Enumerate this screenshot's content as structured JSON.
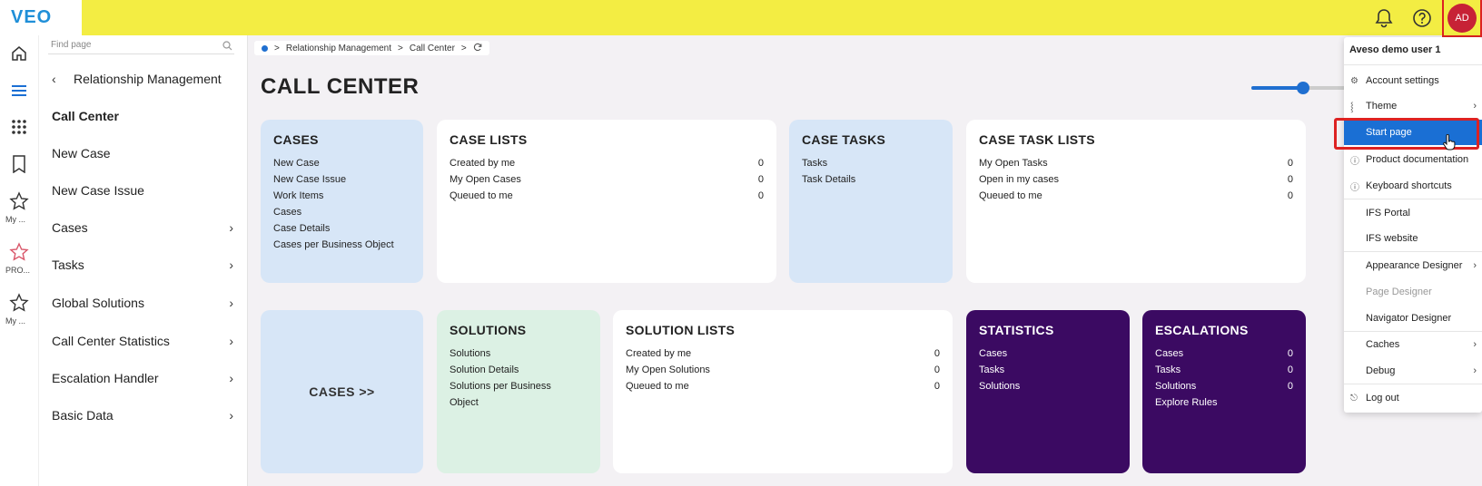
{
  "header": {
    "logo": "VEO",
    "user_initials": "AD",
    "icons": [
      "bell-icon",
      "help-icon"
    ]
  },
  "rail": {
    "labels": {
      "my1": "My ...",
      "pro": "PRO...",
      "my2": "My ..."
    }
  },
  "nav": {
    "search_placeholder": "Find page",
    "back_label": "Relationship Management",
    "items": [
      {
        "label": "Call Center",
        "active": true,
        "has_children": false
      },
      {
        "label": "New Case",
        "has_children": false
      },
      {
        "label": "New Case Issue",
        "has_children": false
      },
      {
        "label": "Cases",
        "has_children": true
      },
      {
        "label": "Tasks",
        "has_children": true
      },
      {
        "label": "Global Solutions",
        "has_children": true
      },
      {
        "label": "Call Center Statistics",
        "has_children": true
      },
      {
        "label": "Escalation Handler",
        "has_children": true
      },
      {
        "label": "Basic Data",
        "has_children": true
      }
    ]
  },
  "breadcrumb": [
    "Relationship Management",
    "Call Center"
  ],
  "page_title": "CALL CENTER",
  "tiles": {
    "cases": {
      "title": "CASES",
      "links": [
        "New Case",
        "New Case Issue",
        "Work Items",
        "Cases",
        "Case Details",
        "Cases per Business Object"
      ]
    },
    "case_lists": {
      "title": "CASE LISTS",
      "rows": [
        {
          "label": "Created by me",
          "value": "0"
        },
        {
          "label": "My Open Cases",
          "value": "0"
        },
        {
          "label": "Queued to me",
          "value": "0"
        }
      ]
    },
    "case_tasks": {
      "title": "CASE TASKS",
      "links": [
        "Tasks",
        "Task Details"
      ]
    },
    "case_task_lists": {
      "title": "CASE TASK LISTS",
      "rows": [
        {
          "label": "My Open Tasks",
          "value": "0"
        },
        {
          "label": "Open in my cases",
          "value": "0"
        },
        {
          "label": "Queued to me",
          "value": "0"
        }
      ]
    },
    "cases_link": {
      "label": "CASES >>"
    },
    "solutions": {
      "title": "SOLUTIONS",
      "links": [
        "Solutions",
        "Solution Details",
        "Solutions per Business",
        "Object"
      ]
    },
    "solution_lists": {
      "title": "SOLUTION LISTS",
      "rows": [
        {
          "label": "Created by me",
          "value": "0"
        },
        {
          "label": "My Open Solutions",
          "value": "0"
        },
        {
          "label": "Queued to me",
          "value": "0"
        }
      ]
    },
    "statistics": {
      "title": "STATISTICS",
      "links": [
        "Cases",
        "Tasks",
        "Solutions"
      ]
    },
    "escalations": {
      "title": "ESCALATIONS",
      "rows": [
        {
          "label": "Cases",
          "value": "0"
        },
        {
          "label": "Tasks",
          "value": "0"
        },
        {
          "label": "Solutions",
          "value": "0"
        },
        {
          "label": "Explore Rules",
          "value": ""
        }
      ]
    }
  },
  "zoom_level": 0.55,
  "user_menu": {
    "user_name": "Aveso demo user 1",
    "items": [
      {
        "label": "Account settings",
        "icon": "gear-icon"
      },
      {
        "label": "Theme",
        "icon": "theme-icon",
        "submenu": true
      },
      {
        "label": "Start page",
        "selected": true
      },
      {
        "label": "Product documentation",
        "icon": "help-icon"
      },
      {
        "label": "Keyboard shortcuts",
        "icon": "help-icon"
      },
      {
        "label": "IFS Portal"
      },
      {
        "label": "IFS website"
      },
      {
        "label": "Appearance Designer",
        "submenu": true
      },
      {
        "label": "Page Designer",
        "disabled": true
      },
      {
        "label": "Navigator Designer"
      },
      {
        "label": "Caches",
        "submenu": true
      },
      {
        "label": "Debug",
        "submenu": true
      },
      {
        "label": "Log out",
        "icon": "logout-icon"
      }
    ]
  },
  "colors": {
    "topbar": "#f3ed43",
    "accent": "#1a6fd4",
    "purple": "#3b0a62",
    "avatar": "#c72236"
  }
}
